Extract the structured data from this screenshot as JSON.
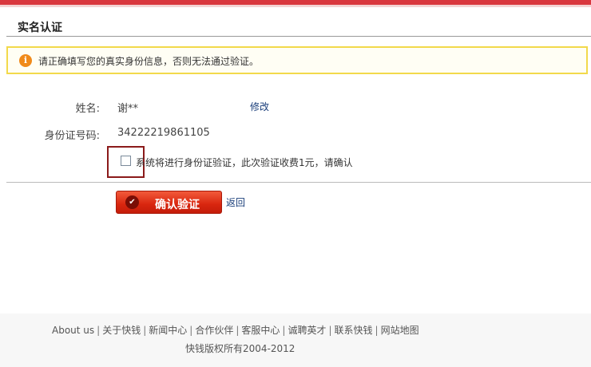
{
  "header": {
    "title": "实名认证"
  },
  "notice": {
    "text": "请正确填写您的真实身份信息，否则无法通过验证。"
  },
  "form": {
    "name_label": "姓名:",
    "name_value": "谢**",
    "edit_label": "修改",
    "id_label": "身份证号码:",
    "id_value": "34222219861105",
    "confirm_text": "系统将进行身份证验证，此次验证收费1元，请确认",
    "confirm_checked": false,
    "submit_label": "确认验证",
    "back_label": "返回"
  },
  "footer": {
    "links": [
      "About us",
      "关于快钱",
      "新闻中心",
      "合作伙伴",
      "客服中心",
      "诚聘英才",
      "联系快钱",
      "网站地图"
    ],
    "copyright": "快钱版权所有2004-2012"
  },
  "colors": {
    "accent": "#d9373e",
    "notice_border": "#f2d94b",
    "button": "#d9260f",
    "link": "#1a3e7a"
  }
}
